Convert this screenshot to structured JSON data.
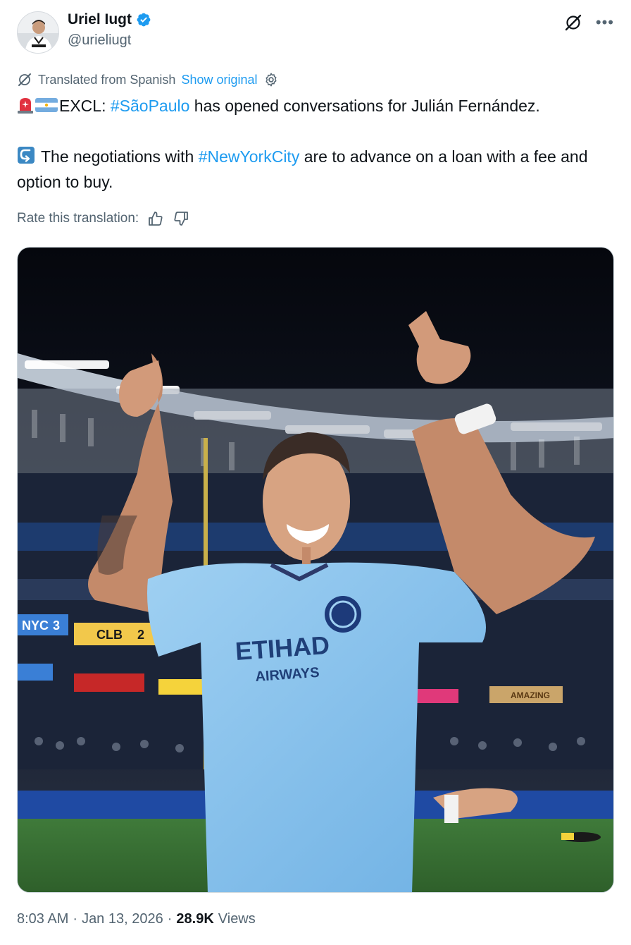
{
  "author": {
    "display_name": "Uriel Iugt",
    "handle": "@urieliugt",
    "verified": true,
    "verified_color": "#1d9bf0",
    "avatar_icon": "profile-photo-avatar"
  },
  "translation": {
    "label": "Translated from Spanish",
    "show_original": "Show original",
    "rate_label": "Rate this translation:"
  },
  "tweet": {
    "line1_prefix": "EXCL: ",
    "line1_hashtag": "#SãoPaulo",
    "line1_suffix": " has opened conversations for Julián Fernández.",
    "line2_prefix": " The negotiations with ",
    "line2_hashtag": "#NewYorkCity",
    "line2_suffix": " are to advance on a loan with a fee and option to buy.",
    "emojis": [
      "rotating-light-emoji",
      "argentina-flag-emoji",
      "right-arrow-curving-left-emoji"
    ],
    "hashtag_color": "#1d9bf0"
  },
  "media": {
    "alt_icon": "football-player-photo",
    "scoreboard_team1": "NYC",
    "scoreboard_score1": "3",
    "scoreboard_team2": "CLB",
    "scoreboard_score2": "2",
    "shirt_sponsor": "ETIHAD",
    "shirt_sponsor_sub": "AIRWAYS",
    "billboard": "AMAZING"
  },
  "meta": {
    "time": "8:03 AM",
    "sep1": "·",
    "date": "Jan 13, 2026",
    "sep2": "·",
    "views_count": "28.9K",
    "views_label": "Views"
  },
  "colors": {
    "text_primary": "#0f1419",
    "text_secondary": "#536471",
    "link": "#1d9bf0"
  }
}
